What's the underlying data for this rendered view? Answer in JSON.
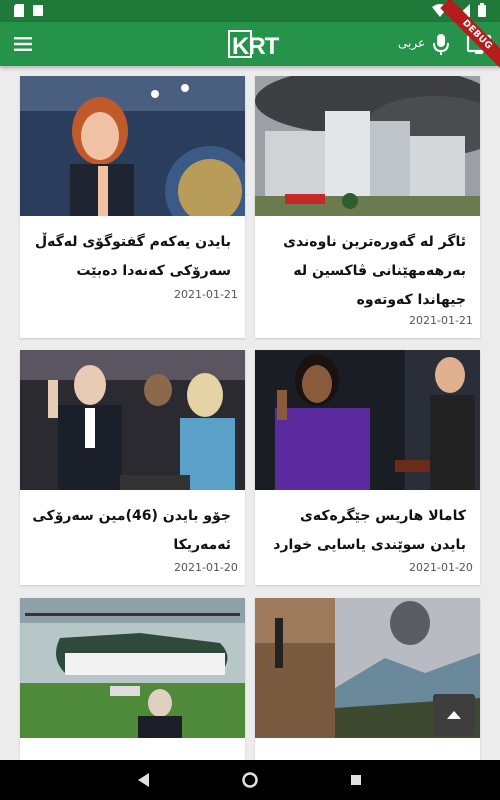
{
  "appbar": {
    "logo_text": "KRT",
    "language_label": "عربی",
    "debug_badge": "DEBUG"
  },
  "cards": [
    {
      "title": "ئاگر لە گەورەترین ناوەندی بەرهەمهێنانی ڤاکسین لە جیهاندا کەوتەوە",
      "date": "2021-01-21"
    },
    {
      "title": "بایدن یەکەم گفتوگۆی لەگەڵ سەرۆکی کەنەدا دەبێت",
      "date": "2021-01-21"
    },
    {
      "title": "کامالا هاریس جێگرەکەی بایدن سوێندی یاسایی خوارد",
      "date": "2021-01-20"
    },
    {
      "title": "جۆو بایدن (46)مین سەرۆکی ئەمەریکا",
      "date": "2021-01-20"
    },
    {
      "title": "",
      "date": ""
    },
    {
      "title": "",
      "date": ""
    }
  ],
  "colors": {
    "status_bar": "#1f7a3a",
    "app_bar": "#25944a",
    "background": "#ececec"
  }
}
